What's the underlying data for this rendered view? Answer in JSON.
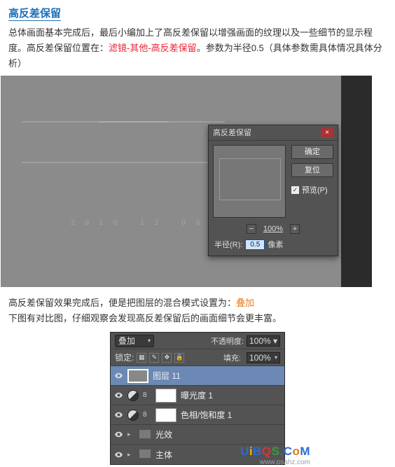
{
  "heading": "高反差保留",
  "para1_a": "总体画面基本完成后，最后小编加上了高反差保留以增强画面的纹理以及一些细节的显示程度。高反差保留位置在：",
  "para1_hl": "滤镜-其他-高反差保留",
  "para1_b": "。参数为半径0.5（具体参数需具体情况具体分析）",
  "canvas_dots": "2 0 1 0 · 1 2 · 0 3",
  "dialog": {
    "title": "高反差保留",
    "btn_ok": "确定",
    "btn_cancel": "复位",
    "preview_chk": "预览(P)",
    "zoom_minus": "−",
    "zoom_pct": "100%",
    "zoom_plus": "+",
    "radius_label": "半径(R):",
    "radius_value": "0.5",
    "radius_unit": "像素"
  },
  "mid_a": "高反差保留效果完成后，便是把图层的混合模式设置为：",
  "mid_hl": "叠加",
  "mid_b": "下图有对比图，仔细观察会发现高反差保留后的画面细节会更丰富。",
  "panel": {
    "blend_mode": "叠加",
    "opacity_label": "不透明度:",
    "opacity_value": "100%",
    "lock_label": "锁定:",
    "fill_label": "填充:",
    "fill_value": "100%",
    "layers": [
      {
        "name": "图层 11"
      },
      {
        "name": "曝光度 1"
      },
      {
        "name": "色相/饱和度 1"
      },
      {
        "name": "光效"
      },
      {
        "name": "主体"
      }
    ]
  },
  "watermark_main": "UiBQS.CoM",
  "watermark_sub": "www.psahz.com"
}
